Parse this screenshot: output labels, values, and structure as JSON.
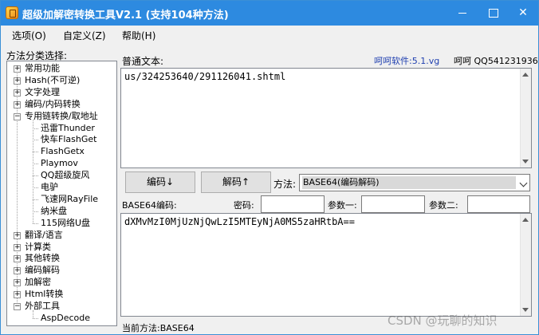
{
  "titlebar": {
    "title": "超级加解密转换工具V2.1 (支持104种方法)"
  },
  "menubar": {
    "items": [
      "选项(O)",
      "自定义(Z)",
      "帮助(H)"
    ]
  },
  "sidebar": {
    "label": "方法分类选择:",
    "tree": [
      {
        "label": "常用功能",
        "expanded": false
      },
      {
        "label": "Hash(不可逆)",
        "expanded": false
      },
      {
        "label": "文字处理",
        "expanded": false
      },
      {
        "label": "编码/内码转换",
        "expanded": false
      },
      {
        "label": "专用链转换/取地址",
        "expanded": true
      },
      {
        "label": "迅雷Thunder",
        "child": true
      },
      {
        "label": "快车FlashGet",
        "child": true
      },
      {
        "label": "FlashGetx",
        "child": true
      },
      {
        "label": "Playmov",
        "child": true
      },
      {
        "label": "QQ超级旋风",
        "child": true
      },
      {
        "label": "电驴",
        "child": true
      },
      {
        "label": "飞速网RayFile",
        "child": true
      },
      {
        "label": "纳米盘",
        "child": true
      },
      {
        "label": "115网络U盘",
        "child": true
      },
      {
        "label": "翻译/语言",
        "expanded": false
      },
      {
        "label": "计算类",
        "expanded": false
      },
      {
        "label": "其他转换",
        "expanded": false
      },
      {
        "label": "编码解码",
        "expanded": false
      },
      {
        "label": "加解密",
        "expanded": false
      },
      {
        "label": "Html转换",
        "expanded": false
      },
      {
        "label": "外部工具",
        "expanded": true
      },
      {
        "label": "AspDecode",
        "child": true
      }
    ]
  },
  "main": {
    "plain_label": "普通文本:",
    "version_text": "呵呵软件:5.1.vg",
    "author_text": "呵呵 QQ541231936",
    "plain_text": "us/324253640/291126041.shtml",
    "encode_button": "编码↓",
    "decode_button": "解码↑",
    "method_label": "方法:",
    "method_value": "BASE64(编码解码)",
    "encoded_label": "BASE64编码:",
    "password_label": "密码:",
    "param1_label": "参数一:",
    "param2_label": "参数二:",
    "encoded_text": "dXMvMzI0MjUzNjQwLzI5MTEyNjA0MS5zaHRtbA==",
    "status": "当前方法:BASE64"
  },
  "watermark": "CSDN @玩聊的知识"
}
